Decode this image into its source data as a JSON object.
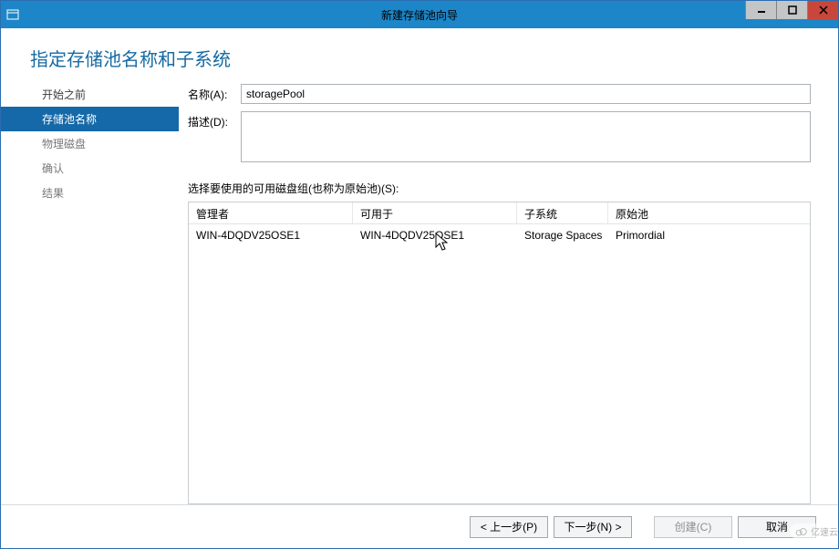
{
  "window": {
    "title": "新建存储池向导"
  },
  "heading": "指定存储池名称和子系统",
  "sidebar": {
    "items": [
      {
        "label": "开始之前",
        "state": "normal"
      },
      {
        "label": "存储池名称",
        "state": "active"
      },
      {
        "label": "物理磁盘",
        "state": "disabled"
      },
      {
        "label": "确认",
        "state": "disabled"
      },
      {
        "label": "结果",
        "state": "disabled"
      }
    ]
  },
  "form": {
    "name_label": "名称(A):",
    "name_value": "storagePool",
    "desc_label": "描述(D):",
    "desc_value": ""
  },
  "disk_group": {
    "label": "选择要使用的可用磁盘组(也称为原始池)(S):",
    "columns": [
      "管理者",
      "可用于",
      "子系统",
      "原始池"
    ],
    "rows": [
      {
        "c0": "WIN-4DQDV25OSE1",
        "c1": "WIN-4DQDV25OSE1",
        "c2": "Storage Spaces",
        "c3": "Primordial"
      }
    ]
  },
  "footer": {
    "prev": "< 上一步(P)",
    "next": "下一步(N) >",
    "create": "创建(C)",
    "cancel": "取消"
  },
  "watermark": "亿速云"
}
